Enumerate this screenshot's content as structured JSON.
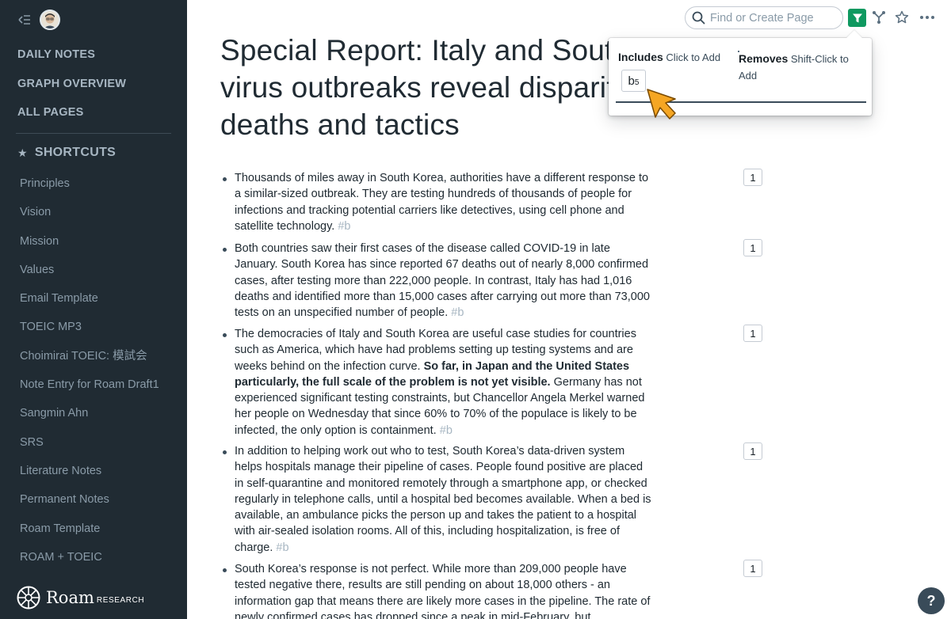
{
  "sidebar": {
    "nav": [
      "DAILY NOTES",
      "GRAPH OVERVIEW",
      "ALL PAGES"
    ],
    "shortcuts_title": "SHORTCUTS",
    "shortcuts": [
      "Principles",
      "Vision",
      "Mission",
      "Values",
      "Email Template",
      "TOEIC MP3",
      "Choimirai TOEIC: 模試会",
      "Note Entry for Roam Draft1",
      "Sangmin Ahn",
      "SRS",
      "Literature Notes",
      "Permanent Notes",
      "Roam Template",
      "ROAM + TOEIC"
    ],
    "logo_word": "Roam",
    "logo_sub": "RESEARCH"
  },
  "topbar": {
    "search_placeholder": "Find or Create Page"
  },
  "filter": {
    "includes_label": "Includes",
    "includes_hint": "Click to Add",
    "removes_label": "Removes",
    "removes_hint": "Shift-Click to Add",
    "chip_label": "b",
    "chip_count": "5"
  },
  "page": {
    "title": "Special Report: Italy and South Korea virus outbreaks reveal disparities in deaths and tactics",
    "blocks": [
      {
        "text": "Thousands of miles away in South Korea, authorities have a different response to a similar-sized outbreak. They are testing hundreds of thousands of people for infections and tracking potential carriers like detectives, using cell phone and satellite technology.",
        "tag": "#b",
        "count": "1"
      },
      {
        "text": "Both countries saw their first cases of the disease called COVID-19 in late January. South Korea has since reported 67 deaths out of nearly 8,000 confirmed cases, after testing more than 222,000 people. In contrast, Italy has had 1,016 deaths and identified more than 15,000 cases after carrying out more than 73,000 tests on an unspecified number of people.",
        "tag": "#b",
        "count": "1"
      },
      {
        "text_before": "The democracies of Italy and South Korea are useful case studies for countries such as America, which have had problems setting up testing systems and are weeks behind on the infection curve.",
        "bold": "So far, in Japan and the United States particularly, the full scale of the problem is not yet visible.",
        "text_after": "Germany has not experienced significant testing constraints, but Chancellor Angela Merkel warned her people on Wednesday that since 60% to 70% of the populace is likely to be infected, the only option is containment.",
        "tag": "#b",
        "count": "1"
      },
      {
        "text": "In addition to helping work out who to test, South Korea’s data-driven system helps hospitals manage their pipeline of cases. People found positive are placed in self-quarantine and monitored remotely through a smartphone app, or checked regularly in telephone calls, until a hospital bed becomes available. When a bed is available, an ambulance picks the person up and takes the patient to a hospital with air-sealed isolation rooms. All of this, including hospitalization, is free of charge.",
        "tag": "#b",
        "count": "1"
      },
      {
        "text": "South Korea’s response is not perfect. While more than 209,000 people have tested negative there, results are still pending on about 18,000 others - an information gap that means there are likely more cases in the pipeline. The rate of newly confirmed cases has dropped since a peak in mid-February, but",
        "count": "1"
      }
    ]
  },
  "help_label": "?"
}
